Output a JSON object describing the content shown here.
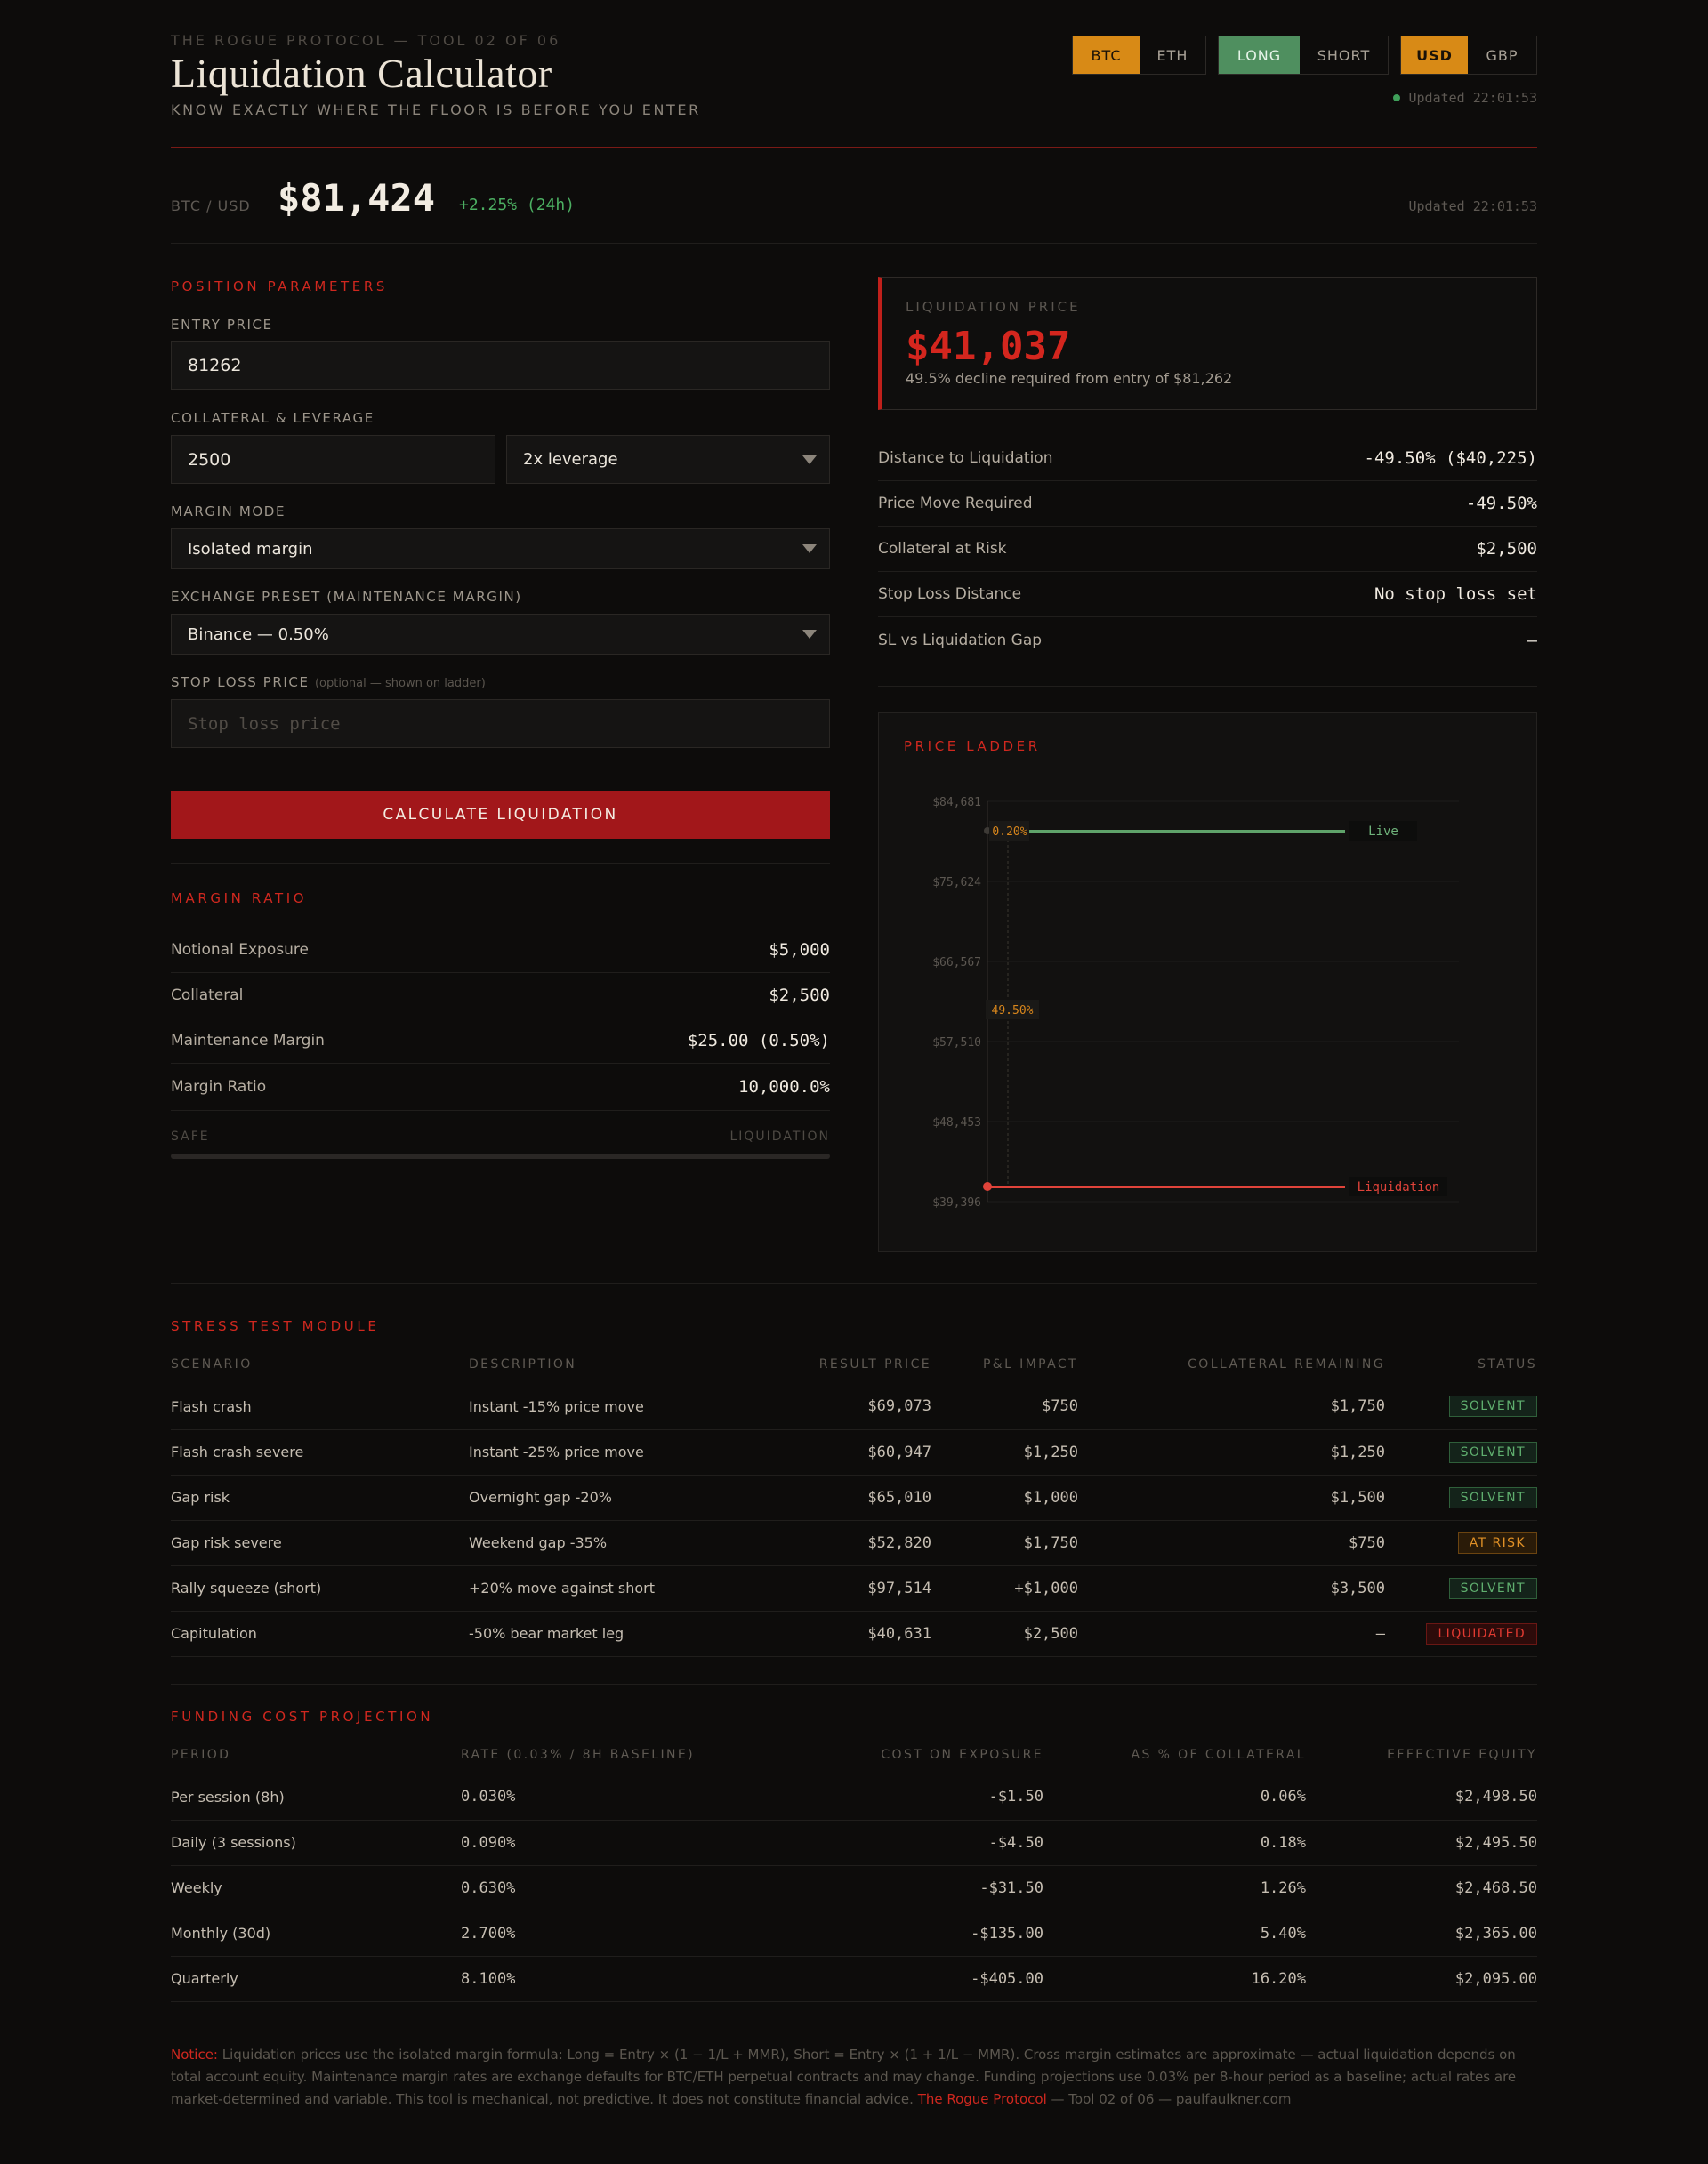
{
  "header": {
    "eyebrow": "THE ROGUE PROTOCOL — TOOL 02 OF 06",
    "title": "Liquidation Calculator",
    "tagline": "KNOW EXACTLY WHERE THE FLOOR IS BEFORE YOU ENTER",
    "asset_toggle": [
      "BTC",
      "ETH"
    ],
    "asset_selected": "BTC",
    "side_toggle": [
      "LONG",
      "SHORT"
    ],
    "side_selected": "LONG",
    "currency_toggle": [
      "USD",
      "GBP"
    ],
    "currency_selected": "USD",
    "updated": "Updated 22:01:53"
  },
  "ticker": {
    "pair": "BTC / USD",
    "price": "$81,424",
    "change": "+2.25% (24h)",
    "updated": "Updated 22:01:53"
  },
  "params": {
    "section_label": "POSITION PARAMETERS",
    "entry_label": "ENTRY PRICE",
    "entry_value": "81262",
    "collateral_label": "COLLATERAL & LEVERAGE",
    "collateral_value": "2500",
    "leverage_value": "2x leverage",
    "margin_mode_label": "MARGIN MODE",
    "margin_mode_value": "Isolated margin",
    "exchange_label": "EXCHANGE PRESET (MAINTENANCE MARGIN)",
    "exchange_value": "Binance — 0.50%",
    "stoploss_label": "STOP LOSS PRICE",
    "stoploss_hint": "(optional — shown on ladder)",
    "stoploss_placeholder": "Stop loss price",
    "calc_button": "CALCULATE LIQUIDATION"
  },
  "margin": {
    "section_label": "MARGIN RATIO",
    "rows": [
      {
        "label": "Notional Exposure",
        "value": "$5,000"
      },
      {
        "label": "Collateral",
        "value": "$2,500"
      },
      {
        "label": "Maintenance Margin",
        "value": "$25.00 (0.50%)"
      },
      {
        "label": "Margin Ratio",
        "value": "10,000.0%"
      }
    ],
    "scale_left": "SAFE",
    "scale_right": "LIQUIDATION",
    "ratio_fill": 0
  },
  "result": {
    "label": "LIQUIDATION PRICE",
    "price": "$41,037",
    "note": "49.5% decline required from entry of $81,262",
    "rows": [
      {
        "label": "Distance to Liquidation",
        "value": "-49.50% ($40,225)"
      },
      {
        "label": "Price Move Required",
        "value": "-49.50%"
      },
      {
        "label": "Collateral at Risk",
        "value": "$2,500"
      },
      {
        "label": "Stop Loss Distance",
        "value": "No stop loss set"
      },
      {
        "label": "SL vs Liquidation Gap",
        "value": "—"
      }
    ]
  },
  "ladder": {
    "section_label": "PRICE LADDER",
    "ticks": [
      "$84,681",
      "$75,624",
      "$66,567",
      "$57,510",
      "$48,453",
      "$39,396"
    ],
    "live_label": "Live",
    "live_pct": "0.20%",
    "gap_pct": "49.50%",
    "liq_label": "Liquidation",
    "colors": {
      "live": "#5fa36a",
      "liq": "#e0433a",
      "gap": "#d8861c"
    }
  },
  "stress": {
    "section_label": "STRESS TEST MODULE",
    "columns": [
      "SCENARIO",
      "DESCRIPTION",
      "RESULT PRICE",
      "P&L IMPACT",
      "COLLATERAL REMAINING",
      "STATUS"
    ],
    "rows": [
      {
        "scenario": "Flash crash",
        "desc": "Instant -15% price move",
        "price": "$69,073",
        "pnl": "$750",
        "remaining": "$1,750",
        "status": "SOLVENT"
      },
      {
        "scenario": "Flash crash severe",
        "desc": "Instant -25% price move",
        "price": "$60,947",
        "pnl": "$1,250",
        "remaining": "$1,250",
        "status": "SOLVENT"
      },
      {
        "scenario": "Gap risk",
        "desc": "Overnight gap -20%",
        "price": "$65,010",
        "pnl": "$1,000",
        "remaining": "$1,500",
        "status": "SOLVENT"
      },
      {
        "scenario": "Gap risk severe",
        "desc": "Weekend gap -35%",
        "price": "$52,820",
        "pnl": "$1,750",
        "remaining": "$750",
        "status": "AT RISK"
      },
      {
        "scenario": "Rally squeeze (short)",
        "desc": "+20% move against short",
        "price": "$97,514",
        "pnl": "+$1,000",
        "remaining": "$3,500",
        "status": "SOLVENT"
      },
      {
        "scenario": "Capitulation",
        "desc": "-50% bear market leg",
        "price": "$40,631",
        "pnl": "$2,500",
        "remaining": "—",
        "status": "LIQUIDATED"
      }
    ]
  },
  "funding": {
    "section_label": "FUNDING COST PROJECTION",
    "columns": [
      "PERIOD",
      "RATE (0.03% / 8H BASELINE)",
      "COST ON EXPOSURE",
      "AS % OF COLLATERAL",
      "EFFECTIVE EQUITY"
    ],
    "rows": [
      {
        "period": "Per session (8h)",
        "rate": "0.030%",
        "cost": "-$1.50",
        "pct": "0.06%",
        "equity": "$2,498.50"
      },
      {
        "period": "Daily (3 sessions)",
        "rate": "0.090%",
        "cost": "-$4.50",
        "pct": "0.18%",
        "equity": "$2,495.50"
      },
      {
        "period": "Weekly",
        "rate": "0.630%",
        "cost": "-$31.50",
        "pct": "1.26%",
        "equity": "$2,468.50"
      },
      {
        "period": "Monthly (30d)",
        "rate": "2.700%",
        "cost": "-$135.00",
        "pct": "5.40%",
        "equity": "$2,365.00"
      },
      {
        "period": "Quarterly",
        "rate": "8.100%",
        "cost": "-$405.00",
        "pct": "16.20%",
        "equity": "$2,095.00"
      }
    ]
  },
  "notice": {
    "lead": "Notice:",
    "body": " Liquidation prices use the isolated margin formula: Long = Entry × (1 − 1/L + MMR), Short = Entry × (1 + 1/L − MMR). Cross margin estimates are approximate — actual liquidation depends on total account equity. Maintenance margin rates are exchange defaults for BTC/ETH perpetual contracts and may change. Funding projections use 0.03% per 8-hour period as a baseline; actual rates are market-determined and variable. This tool is mechanical, not predictive. It does not constitute financial advice. ",
    "brand": "The Rogue Protocol",
    "tail": " — Tool 02 of 06 — paulfaulkner.com"
  }
}
